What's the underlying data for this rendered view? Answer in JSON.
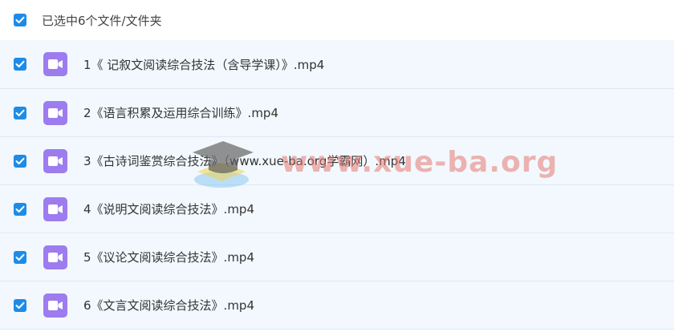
{
  "header": {
    "selection_label": "已选中6个文件/文件夹",
    "checked": true
  },
  "files": [
    {
      "name": "1《 记叙文阅读综合技法（含导学课）》.mp4",
      "checked": true,
      "icon": "video-icon"
    },
    {
      "name": "2《语言积累及运用综合训练》.mp4",
      "checked": true,
      "icon": "video-icon"
    },
    {
      "name": "3《古诗词鉴赏综合技法》（www.xue-ba.org学霸网）.mp4",
      "checked": true,
      "icon": "video-icon"
    },
    {
      "name": "4《说明文阅读综合技法》.mp4",
      "checked": true,
      "icon": "video-icon"
    },
    {
      "name": "5《议论文阅读综合技法》.mp4",
      "checked": true,
      "icon": "video-icon"
    },
    {
      "name": "6《文言文阅读综合技法》.mp4",
      "checked": true,
      "icon": "video-icon"
    }
  ],
  "watermark": {
    "text": "www.xue-ba.org"
  },
  "colors": {
    "checkbox": "#1e8ce6",
    "video_icon": "#9d7cf0",
    "row_background": "#f2f8fe"
  }
}
